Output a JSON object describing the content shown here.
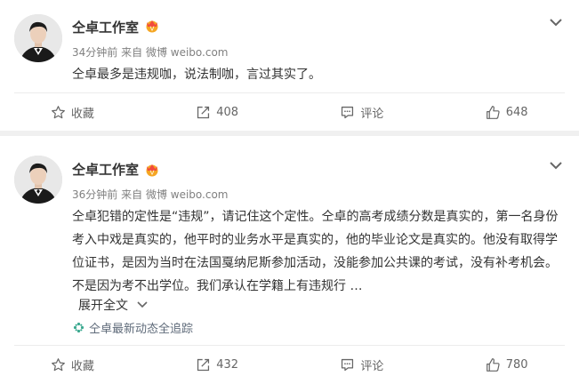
{
  "posts": [
    {
      "author": "仝卓工作室",
      "time": "34分钟前",
      "source_prefix": "来自",
      "source": "微博 weibo.com",
      "text": "仝卓最多是违规咖，说法制咖，言过其实了。",
      "actions": {
        "favorite": "收藏",
        "repost": "408",
        "comment": "评论",
        "like": "648"
      }
    },
    {
      "author": "仝卓工作室",
      "time": "36分钟前",
      "source_prefix": "来自",
      "source": "微博 weibo.com",
      "text": "仝卓犯错的定性是“违规”，请记住这个定性。仝卓的高考成绩分数是真实的，第一名身份考入中戏是真实的，他平时的业务水平是真实的，他的毕业论文是真实的。他没有取得学位证书，是因为当时在法国戛纳尼斯参加活动，没能参加公共课的考试，没有补考机会。不是因为考不出学位。我们承认在学籍上有违规行 …",
      "expand": "展开全文",
      "follow_link": "仝卓最新动态全追踪",
      "actions": {
        "favorite": "收藏",
        "repost": "432",
        "comment": "评论",
        "like": "780"
      }
    }
  ],
  "colors": {
    "badge": "#f5a623",
    "text": "#333333",
    "meta": "#808080",
    "background": "#f0f0f0"
  }
}
